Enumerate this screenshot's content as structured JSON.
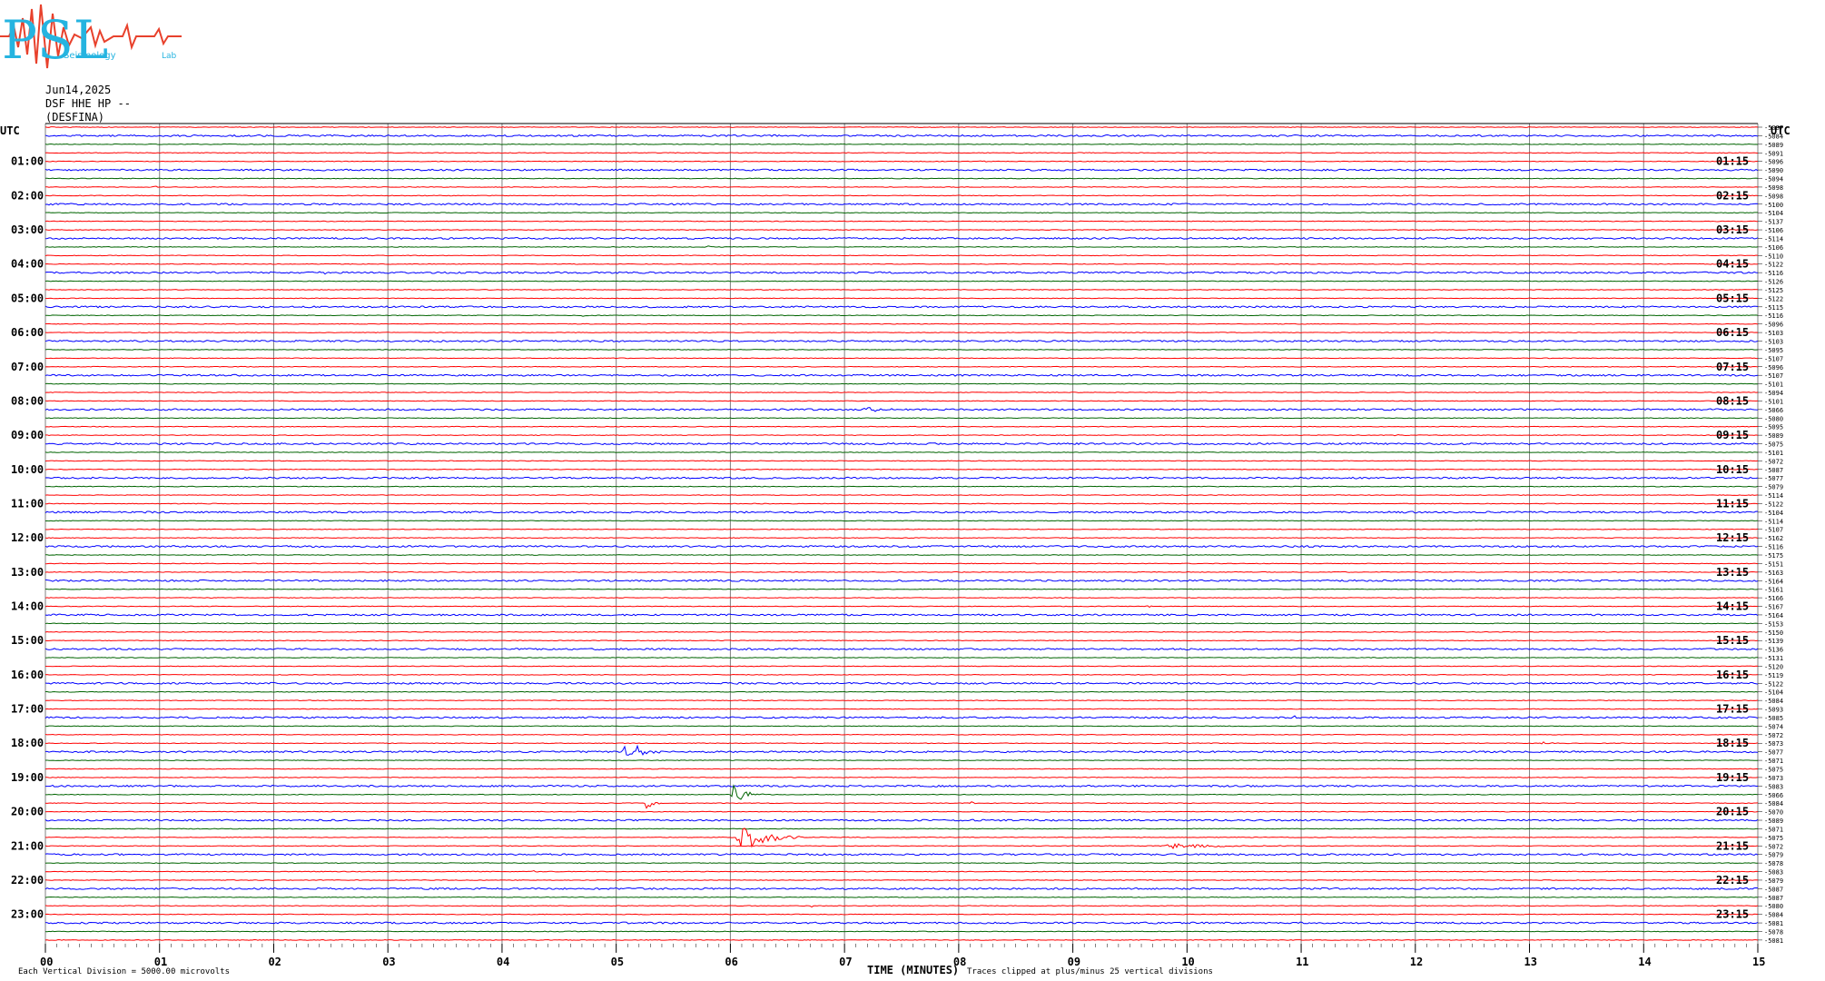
{
  "logo": {
    "text_main": "PSL",
    "text_sub_1": "Seismology",
    "text_sub_2": "Lab",
    "red": "#e8412c",
    "cyan": "#25b4e0"
  },
  "header": {
    "date": "Jun14,2025",
    "station": "DSF HHE HP --",
    "site": "(DESFINA)"
  },
  "footer": {
    "scale": "Each Vertical Division = 5000.00 microvolts",
    "xlabel": "TIME (MINUTES)",
    "clip": "Traces clipped at plus/minus 25 vertical divisions"
  },
  "colors": {
    "red": "#ff0000",
    "blue": "#0000ff",
    "green": "#006400",
    "grid": "#808080"
  },
  "chart_data": {
    "type": "line",
    "title": "",
    "xlabel": "TIME (MINUTES)",
    "xlim": [
      0,
      15
    ],
    "x_ticks": [
      "00",
      "01",
      "02",
      "03",
      "04",
      "05",
      "06",
      "07",
      "08",
      "09",
      "10",
      "11",
      "12",
      "13",
      "14",
      "15"
    ],
    "utc_label_left": "UTC",
    "utc_label_right": "UTC",
    "rows_per_hour": 4,
    "row_colors": [
      "#ff0000",
      "#0000ff",
      "#006400",
      "#ff0000"
    ],
    "left_hour_labels": [
      "01:00",
      "02:00",
      "03:00",
      "04:00",
      "05:00",
      "06:00",
      "07:00",
      "08:00",
      "09:00",
      "10:00",
      "11:00",
      "12:00",
      "13:00",
      "14:00",
      "15:00",
      "16:00",
      "17:00",
      "18:00",
      "19:00",
      "20:00",
      "21:00",
      "22:00",
      "23:00"
    ],
    "right_hour_labels": [
      "01:15",
      "02:15",
      "03:15",
      "04:15",
      "05:15",
      "06:15",
      "07:15",
      "08:15",
      "09:15",
      "10:15",
      "11:15",
      "12:15",
      "13:15",
      "14:15",
      "15:15",
      "16:15",
      "17:15",
      "18:15",
      "19:15",
      "20:15",
      "21:15",
      "22:15",
      "23:15"
    ],
    "right_values": [
      "-5087",
      "-5084",
      "-5089",
      "-5091",
      "-5096",
      "-5090",
      "-5094",
      "-5098",
      "-5098",
      "-5100",
      "-5104",
      "-5137",
      "-5106",
      "-5114",
      "-5106",
      "-5110",
      "-5122",
      "-5116",
      "-5126",
      "-5125",
      "-5122",
      "-5115",
      "-5116",
      "-5096",
      "-5103",
      "-5103",
      "-5095",
      "-5107",
      "-5096",
      "-5107",
      "-5101",
      "-5094",
      "-5101",
      "-5066",
      "-5080",
      "-5095",
      "-5089",
      "-5075",
      "-5101",
      "-5072",
      "-5087",
      "-5077",
      "-5079",
      "-5114",
      "-5122",
      "-5104",
      "-5114",
      "-5107",
      "-5162",
      "-5116",
      "-5175",
      "-5151",
      "-5163",
      "-5164",
      "-5161",
      "-5166",
      "-5167",
      "-5164",
      "-5153",
      "-5150",
      "-5139",
      "-5136",
      "-5131",
      "-5120",
      "-5119",
      "-5122",
      "-5104",
      "-5084",
      "-5093",
      "-5085",
      "-5074",
      "-5072",
      "-5073",
      "-5077",
      "-5071",
      "-5075",
      "-5073",
      "-5083",
      "-5066",
      "-5084",
      "-5070",
      "-5089",
      "-5071",
      "-5075",
      "-5072",
      "-5079",
      "-5078",
      "-5083",
      "-5079",
      "-5087",
      "-5087",
      "-5080",
      "-5084",
      "-5081",
      "-5078",
      "-5081"
    ],
    "events": [
      {
        "row": 4,
        "minute": 8.15,
        "amp": 0.8,
        "dur": 0.15
      },
      {
        "row": 7,
        "minute": 0.95,
        "amp": 0.8,
        "dur": 0.1
      },
      {
        "row": 14,
        "minute": 5.8,
        "amp": 0.8,
        "dur": 0.1
      },
      {
        "row": 17,
        "minute": 2.4,
        "amp": 1.2,
        "dur": 0.25
      },
      {
        "row": 22,
        "minute": 4.7,
        "amp": 0.8,
        "dur": 0.15
      },
      {
        "row": 33,
        "minute": 7.15,
        "amp": 1.5,
        "dur": 0.5
      },
      {
        "row": 36,
        "minute": 11.8,
        "amp": 1.0,
        "dur": 0.1
      },
      {
        "row": 37,
        "minute": 13.35,
        "amp": 1.0,
        "dur": 0.1
      },
      {
        "row": 40,
        "minute": 6.1,
        "amp": 0.8,
        "dur": 0.1
      },
      {
        "row": 45,
        "minute": 13.35,
        "amp": 1.0,
        "dur": 0.15
      },
      {
        "row": 56,
        "minute": 9.65,
        "amp": 0.8,
        "dur": 0.15
      },
      {
        "row": 69,
        "minute": 10.9,
        "amp": 1.2,
        "dur": 0.2
      },
      {
        "row": 72,
        "minute": 13.1,
        "amp": 1.0,
        "dur": 0.3
      },
      {
        "row": 73,
        "minute": 5.05,
        "amp": 9.0,
        "dur": 0.35
      },
      {
        "row": 78,
        "minute": 6.0,
        "amp": 7.0,
        "dur": 0.3
      },
      {
        "row": 79,
        "minute": 5.25,
        "amp": 4.0,
        "dur": 0.2
      },
      {
        "row": 79,
        "minute": 8.1,
        "amp": 1.0,
        "dur": 0.2
      },
      {
        "row": 83,
        "minute": 6.05,
        "amp": 10.0,
        "dur": 0.6
      },
      {
        "row": 84,
        "minute": 9.8,
        "amp": 1.8,
        "dur": 1.1
      },
      {
        "row": 87,
        "minute": 4.25,
        "amp": 1.2,
        "dur": 0.1
      },
      {
        "row": 91,
        "minute": 6.7,
        "amp": 1.5,
        "dur": 0.1
      }
    ]
  }
}
